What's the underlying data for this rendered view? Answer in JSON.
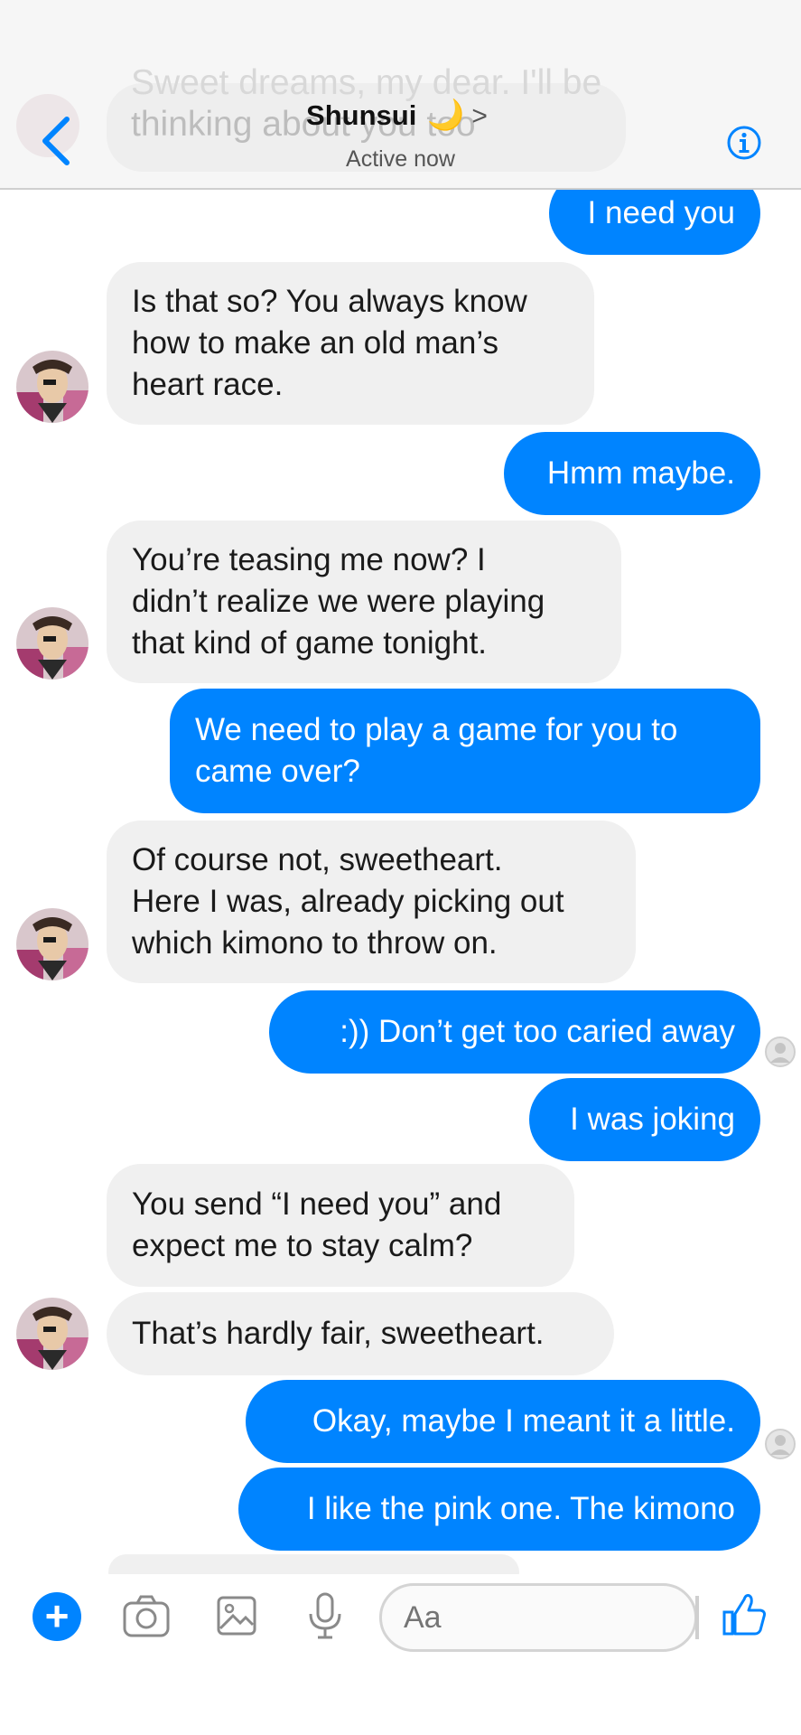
{
  "header": {
    "ghost_top": "Sweet dreams, my dear. I'll be",
    "ghost_text": "thinking about you too",
    "contact_name": "Shunsui",
    "moon": "🌙",
    "chevron": ">",
    "status": "Active now"
  },
  "messages": [
    {
      "dir": "out",
      "text": "I need you"
    },
    {
      "dir": "in",
      "lines": [
        "Is that so? You always know",
        "how to make an old man’s",
        "heart race."
      ]
    },
    {
      "dir": "out",
      "text": "Hmm maybe."
    },
    {
      "dir": "in",
      "lines": [
        "You’re teasing me now? I",
        "didn’t realize we were playing",
        "that kind of game tonight."
      ]
    },
    {
      "dir": "out",
      "lines": [
        "We need to play a game for you to",
        "came over?"
      ]
    },
    {
      "dir": "in",
      "lines": [
        "Of course not, sweetheart.",
        "Here I was, already picking out",
        "which kimono to throw on."
      ]
    },
    {
      "dir": "out",
      "text": ":)) Don’t get too caried away"
    },
    {
      "dir": "out",
      "text": "I was joking"
    },
    {
      "dir": "in",
      "lines": [
        "You send “I need you” and",
        "expect me to stay calm?"
      ]
    },
    {
      "dir": "in",
      "text": "That’s hardly fair, sweetheart."
    },
    {
      "dir": "out",
      "text": "Okay, maybe I meant it a little."
    },
    {
      "dir": "out",
      "text": "I like the pink one. The kimono"
    }
  ],
  "composer": {
    "plus": "+",
    "placeholder": "Aa"
  },
  "colors": {
    "accent": "#0084ff",
    "incoming_bubble": "#f0f0f0",
    "header_bg": "#f6f6f6"
  },
  "icons": [
    "back-chevron-icon",
    "info-icon",
    "camera-icon",
    "image-icon",
    "microphone-icon",
    "thumbs-up-icon",
    "avatar-icon",
    "read-receipt-icon"
  ]
}
